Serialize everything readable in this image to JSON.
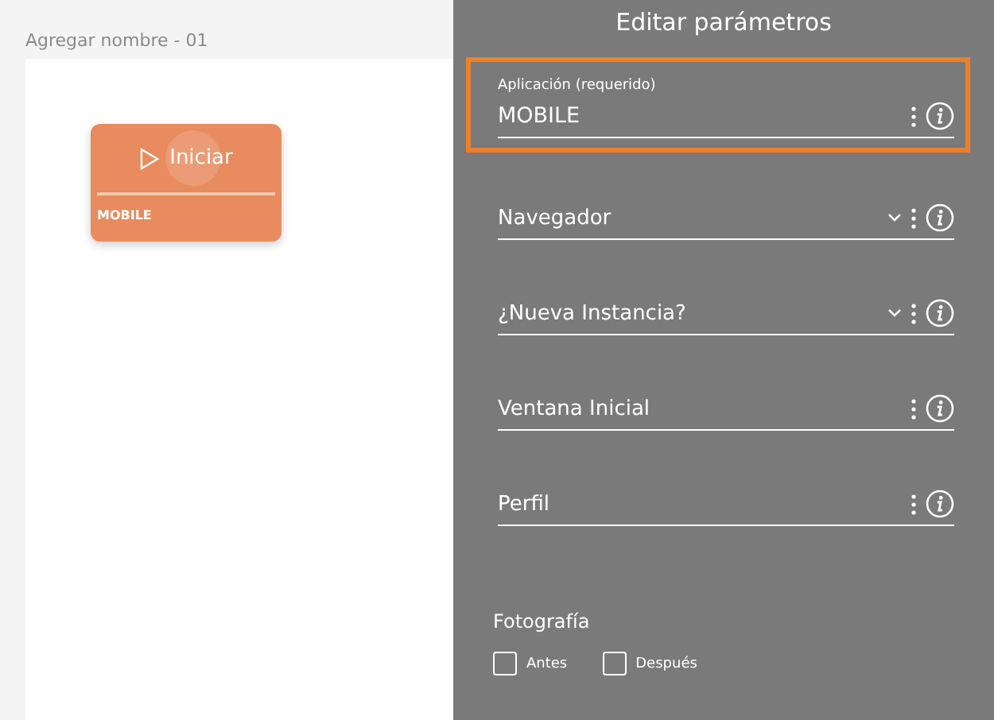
{
  "canvas": {
    "title": "Agregar nombre - 01",
    "node": {
      "label": "Iniciar",
      "caption": "MOBILE",
      "highlighted": true
    }
  },
  "panel": {
    "title": "Editar parámetros",
    "fields": [
      {
        "kind": "text",
        "label": "Aplicación (requerido)",
        "value": "MOBILE",
        "focused": true
      },
      {
        "kind": "select",
        "placeholder": "Navegador",
        "focused": false
      },
      {
        "kind": "select",
        "placeholder": "¿Nueva Instancia?",
        "focused": false
      },
      {
        "kind": "text",
        "placeholder": "Ventana Inicial",
        "focused": false
      },
      {
        "kind": "text",
        "placeholder": "Perfil",
        "focused": false
      }
    ],
    "photo": {
      "title": "Fotografía",
      "options": [
        {
          "label": "Antes",
          "checked": false
        },
        {
          "label": "Después",
          "checked": false
        }
      ]
    }
  }
}
